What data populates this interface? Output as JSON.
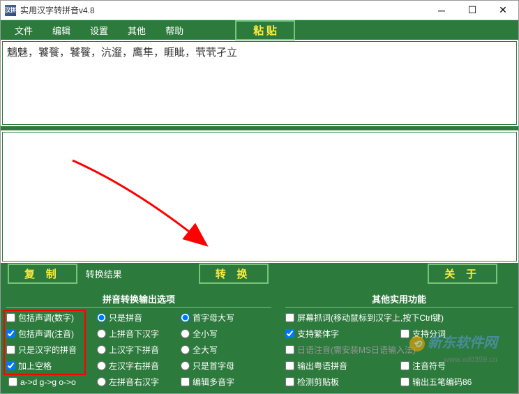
{
  "window": {
    "icon_text": "汉拼",
    "title": "实用汉字转拼音v4.8"
  },
  "menu": {
    "file": "文件",
    "edit": "编辑",
    "settings": "设置",
    "other": "其他",
    "help": "帮助",
    "paste": "粘 贴"
  },
  "input_text": "魑魅，饕餮，饕餮，沆瀣，鹰隼，睚眦，茕茕孑立",
  "buttons": {
    "copy": "复 制",
    "result_label": "转换结果",
    "convert": "转 换",
    "about": "关 于"
  },
  "left_panel": {
    "title": "拼音转换输出选项",
    "col1": {
      "tone_number": "包括声调(数字)",
      "tone_zhuyin": "包括声调(注音)",
      "only_hanzi_pinyin": "只是汉字的拼音",
      "add_space": "加上空格",
      "adg": "a->d g->g o->o"
    },
    "col2": {
      "only_pinyin": "只是拼音",
      "pinyin_above": "上拼音下汉字",
      "hanzi_above": "上汉字下拼音",
      "left_hanzi": "左汉字右拼音",
      "left_pinyin": "左拼音右汉字"
    },
    "col3": {
      "first_upper": "首字母大写",
      "all_lower": "全小写",
      "all_upper": "全大写",
      "only_first": "只是首字母",
      "edit_polyphonic": "编辑多音字"
    }
  },
  "right_panel": {
    "title": "其他实用功能",
    "screen_grab": "屏幕抓词(移动鼠标到汉字上,按下Ctrl键)",
    "traditional": "支持繁体字",
    "word_split": "支持分词",
    "japanese": "日语注音(需安装MS日语输入法)",
    "yueyu": "输出粤语拼音",
    "zhuyin_symbol": "注音符号",
    "check_clipboard": "检测剪贴板",
    "wubi": "输出五笔编码86"
  },
  "watermark": {
    "site": "新东软件网",
    "url": "www.xd0359.cn"
  }
}
